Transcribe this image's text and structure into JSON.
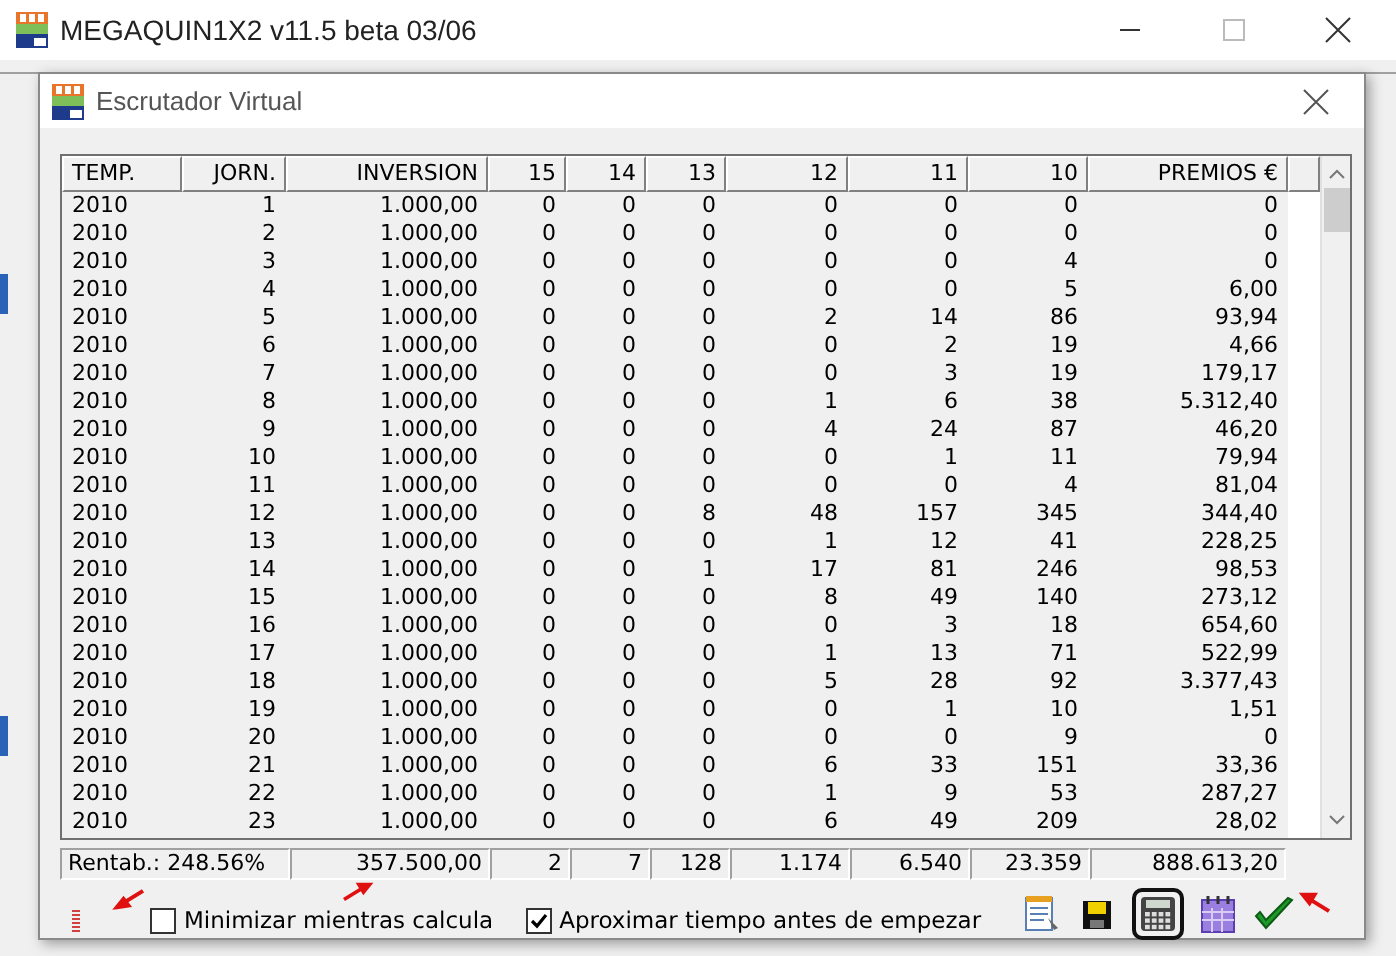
{
  "app_window": {
    "title": "MEGAQUIN1X2 v11.5 beta 03/06"
  },
  "dialog": {
    "title": "Escrutador Virtual"
  },
  "table": {
    "columns": [
      "TEMP.",
      "JORN.",
      "INVERSION",
      "15",
      "14",
      "13",
      "12",
      "11",
      "10",
      "PREMIOS €"
    ],
    "rows": [
      [
        "2010",
        "1",
        "1.000,00",
        "0",
        "0",
        "0",
        "0",
        "0",
        "0",
        "0"
      ],
      [
        "2010",
        "2",
        "1.000,00",
        "0",
        "0",
        "0",
        "0",
        "0",
        "0",
        "0"
      ],
      [
        "2010",
        "3",
        "1.000,00",
        "0",
        "0",
        "0",
        "0",
        "0",
        "4",
        "0"
      ],
      [
        "2010",
        "4",
        "1.000,00",
        "0",
        "0",
        "0",
        "0",
        "0",
        "5",
        "6,00"
      ],
      [
        "2010",
        "5",
        "1.000,00",
        "0",
        "0",
        "0",
        "2",
        "14",
        "86",
        "93,94"
      ],
      [
        "2010",
        "6",
        "1.000,00",
        "0",
        "0",
        "0",
        "0",
        "2",
        "19",
        "4,66"
      ],
      [
        "2010",
        "7",
        "1.000,00",
        "0",
        "0",
        "0",
        "0",
        "3",
        "19",
        "179,17"
      ],
      [
        "2010",
        "8",
        "1.000,00",
        "0",
        "0",
        "0",
        "1",
        "6",
        "38",
        "5.312,40"
      ],
      [
        "2010",
        "9",
        "1.000,00",
        "0",
        "0",
        "0",
        "4",
        "24",
        "87",
        "46,20"
      ],
      [
        "2010",
        "10",
        "1.000,00",
        "0",
        "0",
        "0",
        "0",
        "1",
        "11",
        "79,94"
      ],
      [
        "2010",
        "11",
        "1.000,00",
        "0",
        "0",
        "0",
        "0",
        "0",
        "4",
        "81,04"
      ],
      [
        "2010",
        "12",
        "1.000,00",
        "0",
        "0",
        "8",
        "48",
        "157",
        "345",
        "344,40"
      ],
      [
        "2010",
        "13",
        "1.000,00",
        "0",
        "0",
        "0",
        "1",
        "12",
        "41",
        "228,25"
      ],
      [
        "2010",
        "14",
        "1.000,00",
        "0",
        "0",
        "1",
        "17",
        "81",
        "246",
        "98,53"
      ],
      [
        "2010",
        "15",
        "1.000,00",
        "0",
        "0",
        "0",
        "8",
        "49",
        "140",
        "273,12"
      ],
      [
        "2010",
        "16",
        "1.000,00",
        "0",
        "0",
        "0",
        "0",
        "3",
        "18",
        "654,60"
      ],
      [
        "2010",
        "17",
        "1.000,00",
        "0",
        "0",
        "0",
        "1",
        "13",
        "71",
        "522,99"
      ],
      [
        "2010",
        "18",
        "1.000,00",
        "0",
        "0",
        "0",
        "5",
        "28",
        "92",
        "3.377,43"
      ],
      [
        "2010",
        "19",
        "1.000,00",
        "0",
        "0",
        "0",
        "0",
        "1",
        "10",
        "1,51"
      ],
      [
        "2010",
        "20",
        "1.000,00",
        "0",
        "0",
        "0",
        "0",
        "0",
        "9",
        "0"
      ],
      [
        "2010",
        "21",
        "1.000,00",
        "0",
        "0",
        "0",
        "6",
        "33",
        "151",
        "33,36"
      ],
      [
        "2010",
        "22",
        "1.000,00",
        "0",
        "0",
        "0",
        "1",
        "9",
        "53",
        "287,27"
      ],
      [
        "2010",
        "23",
        "1.000,00",
        "0",
        "0",
        "0",
        "6",
        "49",
        "209",
        "28,02"
      ]
    ]
  },
  "totals": [
    "Rentab.: 248.56%",
    "357.500,00",
    "2",
    "7",
    "128",
    "1.174",
    "6.540",
    "23.359",
    "888.613,20"
  ],
  "options": [
    {
      "label": "Minimizar mientras calcula",
      "checked": false
    },
    {
      "label": "Aproximar tiempo antes de empezar",
      "checked": true
    }
  ],
  "tools": [
    {
      "kind": "notepad",
      "selected": false
    },
    {
      "kind": "save",
      "selected": false
    },
    {
      "kind": "calculator",
      "selected": true
    },
    {
      "kind": "calendar",
      "selected": false
    },
    {
      "kind": "check",
      "selected": false
    }
  ]
}
